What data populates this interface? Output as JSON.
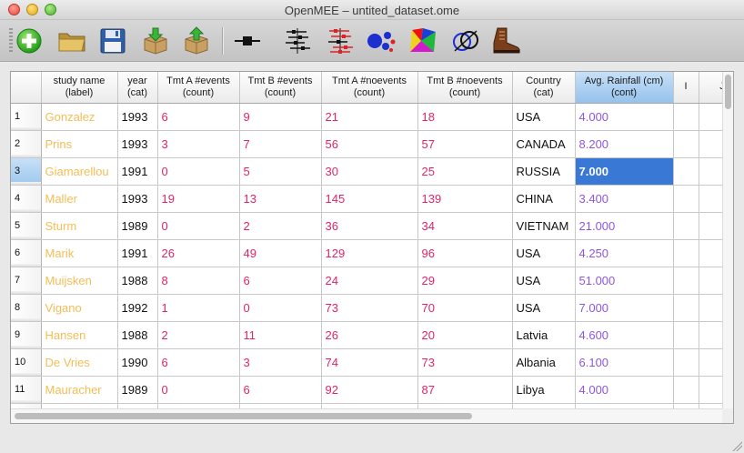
{
  "window": {
    "title": "OpenMEE – untited_dataset.ome"
  },
  "toolbar": {
    "buttons": [
      {
        "name": "new-dataset-button",
        "icon": "green-plus-icon"
      },
      {
        "name": "open-dataset-button",
        "icon": "folder-icon"
      },
      {
        "name": "save-dataset-button",
        "icon": "floppy-disk-icon"
      },
      {
        "name": "import-button",
        "icon": "box-import-icon"
      },
      {
        "name": "export-button",
        "icon": "box-export-icon"
      },
      {
        "name": "calculate-effect-size-button",
        "icon": "effect-size-icon"
      },
      {
        "name": "meta-analysis-button",
        "icon": "forest-plot-icon"
      },
      {
        "name": "subgroup-analysis-button",
        "icon": "subgroup-forest-icon"
      },
      {
        "name": "cluster-analysis-button",
        "icon": "blue-dots-icon"
      },
      {
        "name": "meta-regression-button",
        "icon": "color-polygons-icon"
      },
      {
        "name": "venn-analysis-button",
        "icon": "venn-circles-icon"
      },
      {
        "name": "boot-analysis-button",
        "icon": "boot-icon"
      }
    ]
  },
  "table": {
    "columns": [
      {
        "line1": "",
        "line2": ""
      },
      {
        "line1": "study name",
        "line2": "(label)"
      },
      {
        "line1": "year",
        "line2": "(cat)"
      },
      {
        "line1": "Tmt A #events",
        "line2": "(count)"
      },
      {
        "line1": "Tmt B #events",
        "line2": "(count)"
      },
      {
        "line1": "Tmt A #noevents",
        "line2": "(count)"
      },
      {
        "line1": "Tmt B #noevents",
        "line2": "(count)"
      },
      {
        "line1": "Country",
        "line2": "(cat)"
      },
      {
        "line1": "Avg. Rainfall (cm)",
        "line2": "(cont)"
      },
      {
        "line1": "I",
        "line2": ""
      },
      {
        "line1": "J",
        "line2": ""
      }
    ],
    "selected_column_index": 8,
    "selected_row_index": 2,
    "rows": [
      {
        "num": "1",
        "name": "Gonzalez",
        "year": "1993",
        "a_events": "6",
        "b_events": "9",
        "a_noevents": "21",
        "b_noevents": "18",
        "country": "USA",
        "rainfall": "4.000"
      },
      {
        "num": "2",
        "name": "Prins",
        "year": "1993",
        "a_events": "3",
        "b_events": "7",
        "a_noevents": "56",
        "b_noevents": "57",
        "country": "CANADA",
        "rainfall": "8.200"
      },
      {
        "num": "3",
        "name": "Giamarellou",
        "year": "1991",
        "a_events": "0",
        "b_events": "5",
        "a_noevents": "30",
        "b_noevents": "25",
        "country": "RUSSIA",
        "rainfall": "7.000"
      },
      {
        "num": "4",
        "name": "Maller",
        "year": "1993",
        "a_events": "19",
        "b_events": "13",
        "a_noevents": "145",
        "b_noevents": "139",
        "country": "CHINA",
        "rainfall": "3.400"
      },
      {
        "num": "5",
        "name": "Sturm",
        "year": "1989",
        "a_events": "0",
        "b_events": "2",
        "a_noevents": "36",
        "b_noevents": "34",
        "country": "VIETNAM",
        "rainfall": "21.000"
      },
      {
        "num": "6",
        "name": "Marik",
        "year": "1991",
        "a_events": "26",
        "b_events": "49",
        "a_noevents": "129",
        "b_noevents": "96",
        "country": "USA",
        "rainfall": "4.250"
      },
      {
        "num": "7",
        "name": "Muijsken",
        "year": "1988",
        "a_events": "8",
        "b_events": "6",
        "a_noevents": "24",
        "b_noevents": "29",
        "country": "USA",
        "rainfall": "51.000"
      },
      {
        "num": "8",
        "name": "Vigano",
        "year": "1992",
        "a_events": "1",
        "b_events": "0",
        "a_noevents": "73",
        "b_noevents": "70",
        "country": "USA",
        "rainfall": "7.000"
      },
      {
        "num": "9",
        "name": "Hansen",
        "year": "1988",
        "a_events": "2",
        "b_events": "11",
        "a_noevents": "26",
        "b_noevents": "20",
        "country": "Latvia",
        "rainfall": "4.600"
      },
      {
        "num": "10",
        "name": "De Vries",
        "year": "1990",
        "a_events": "6",
        "b_events": "3",
        "a_noevents": "74",
        "b_noevents": "73",
        "country": "Albania",
        "rainfall": "6.100"
      },
      {
        "num": "11",
        "name": "Mauracher",
        "year": "1989",
        "a_events": "0",
        "b_events": "6",
        "a_noevents": "92",
        "b_noevents": "87",
        "country": "Libya",
        "rainfall": "4.000"
      },
      {
        "num": "",
        "name": "",
        "year": "",
        "a_events": "",
        "b_events": "",
        "a_noevents": "",
        "b_noevents": "",
        "country": "",
        "rainfall": ""
      }
    ]
  },
  "colors": {
    "label": "#f3bd55",
    "count": "#e0246a",
    "cont": "#8f56e0",
    "selection": "#3a78d6"
  }
}
